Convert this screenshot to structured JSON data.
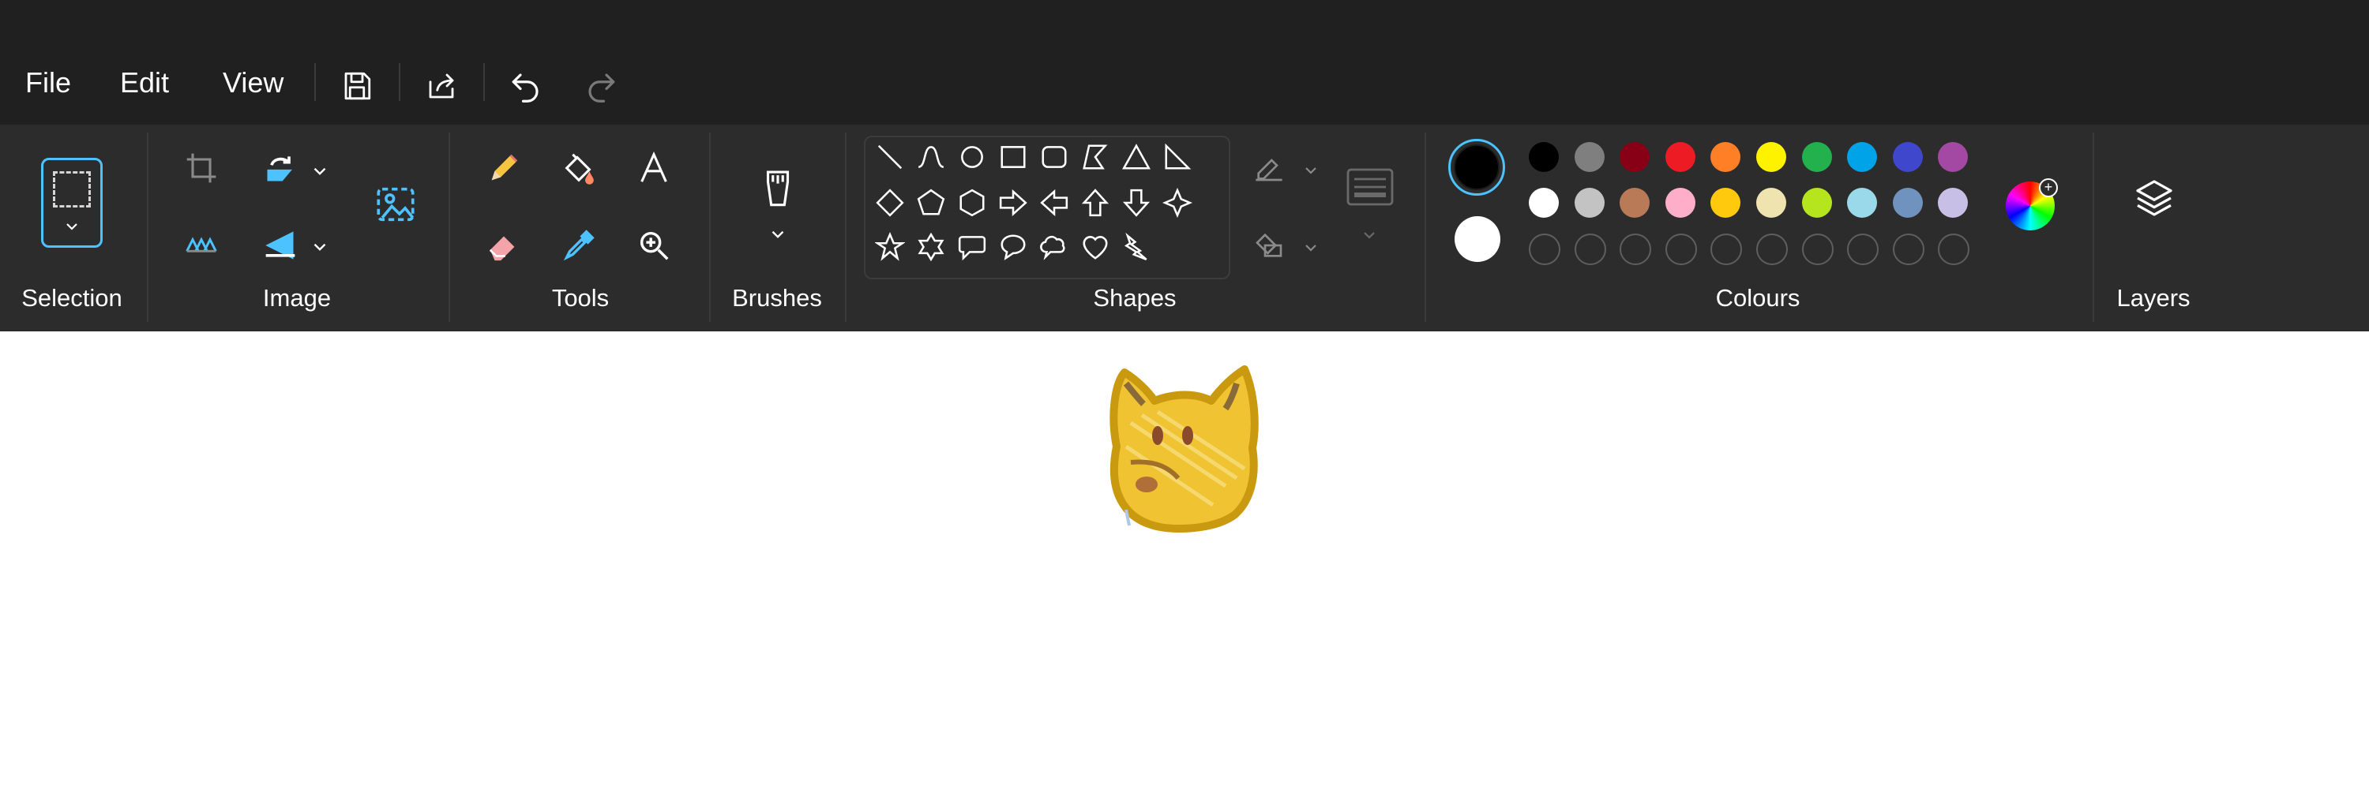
{
  "menu": {
    "file": "File",
    "edit": "Edit",
    "view": "View"
  },
  "quick_access": [
    "save-icon",
    "share-icon",
    "undo-icon",
    "redo-icon"
  ],
  "ribbon": {
    "groups": {
      "selection": "Selection",
      "image": "Image",
      "tools": "Tools",
      "brushes": "Brushes",
      "shapes": "Shapes",
      "colours": "Colours",
      "layers": "Layers"
    },
    "image_tools": [
      "crop-icon",
      "rotate-icon",
      "resize-icon",
      "flip-icon",
      "remove-background-icon"
    ],
    "tools": [
      "pencil-icon",
      "fill-icon",
      "text-icon",
      "eraser-icon",
      "colour-picker-icon",
      "magnifier-icon"
    ],
    "shape_tools": [
      "line",
      "curve",
      "oval",
      "rectangle",
      "rounded-rectangle",
      "polygon",
      "triangle",
      "right-triangle",
      "diamond",
      "pentagon",
      "hexagon",
      "right-arrow",
      "left-arrow",
      "up-arrow",
      "down-arrow",
      "four-point-star",
      "five-point-star",
      "six-point-star",
      "rounded-rectangular-callout",
      "oval-callout",
      "cloud-callout",
      "heart",
      "lightning"
    ],
    "shape_options": [
      "outline-icon",
      "fill-icon"
    ]
  },
  "colours": {
    "primary": "#000000",
    "secondary": "#ffffff",
    "accent": "#4cc2ff",
    "palette_row1": [
      "#000000",
      "#7f7f7f",
      "#880015",
      "#ed1c24",
      "#ff7f27",
      "#fff200",
      "#22b14c",
      "#00a2e8",
      "#3f48cc",
      "#a349a4"
    ],
    "palette_row2": [
      "#ffffff",
      "#c3c3c3",
      "#b97a57",
      "#ffaec9",
      "#ffc90e",
      "#efe4b0",
      "#b5e61d",
      "#99d9ea",
      "#7092be",
      "#c8bfe7"
    ],
    "custom_slots": 10
  }
}
